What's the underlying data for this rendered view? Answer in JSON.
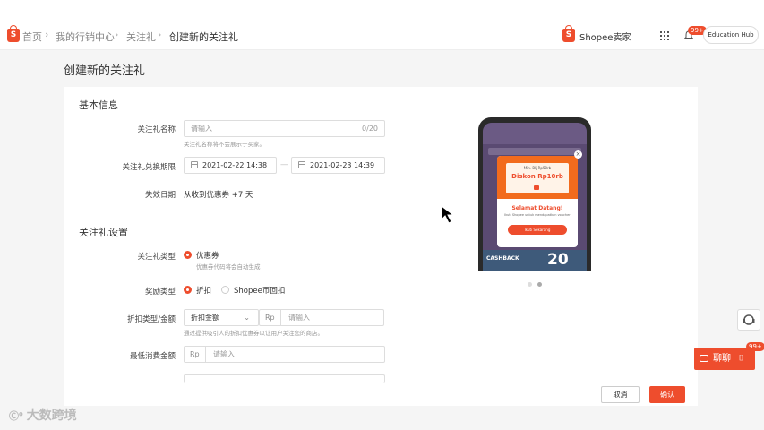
{
  "breadcrumb": {
    "home": "首页",
    "marketing": "我的行销中心",
    "follow_prize": "关注礼",
    "current": "创建新的关注礼"
  },
  "header": {
    "seller_label": "Shopee卖家",
    "notification_badge": "99+",
    "edu_hub": "Education Hub"
  },
  "page_title": "创建新的关注礼",
  "basic_info": {
    "section_title": "基本信息",
    "name_label": "关注礼名称",
    "name_placeholder": "请输入",
    "name_counter": "0/20",
    "name_hint": "关注礼名称将不会展示于买家。",
    "period_label": "关注礼兑换期限",
    "period_start": "2021-02-22 14:38",
    "period_sep": "—",
    "period_end": "2021-02-23 14:39",
    "expiry_label": "失效日期",
    "expiry_value": "从收到优惠券 +7 天"
  },
  "settings": {
    "section_title": "关注礼设置",
    "type_label": "关注礼类型",
    "type_option": "优惠券",
    "type_hint": "优惠券代码将会自动生成",
    "reward_label": "奖励类型",
    "reward_opt_discount": "折扣",
    "reward_opt_coins": "Shopee币回扣",
    "discount_label": "折扣类型/金额",
    "discount_select": "折扣金额",
    "currency": "Rp",
    "amount_placeholder": "请输入",
    "discount_hint": "通过提供吸引人的折扣优惠券以让用户关注您的商店。",
    "min_spend_label": "最低消费金额",
    "min_spend_placeholder": "请输入"
  },
  "preview": {
    "voucher_line1": "Min. Blj Rp50rb",
    "voucher_amount": "Diskon Rp10rb",
    "welcome": "Selamat Datang!",
    "welcome_sub": "Ikuti Shopee untuk mendapatkan voucher",
    "cta": "Ikuti Sekarang",
    "promo": "20",
    "cashback": "CASHBACK"
  },
  "actions": {
    "cancel": "取消",
    "confirm": "确认"
  },
  "floating": {
    "chat_label": "聊聊",
    "chat_badge": "99+"
  },
  "watermark": "大数跨境",
  "colors": {
    "accent": "#ee4d2d",
    "popup_orange": "#f26b1d"
  }
}
